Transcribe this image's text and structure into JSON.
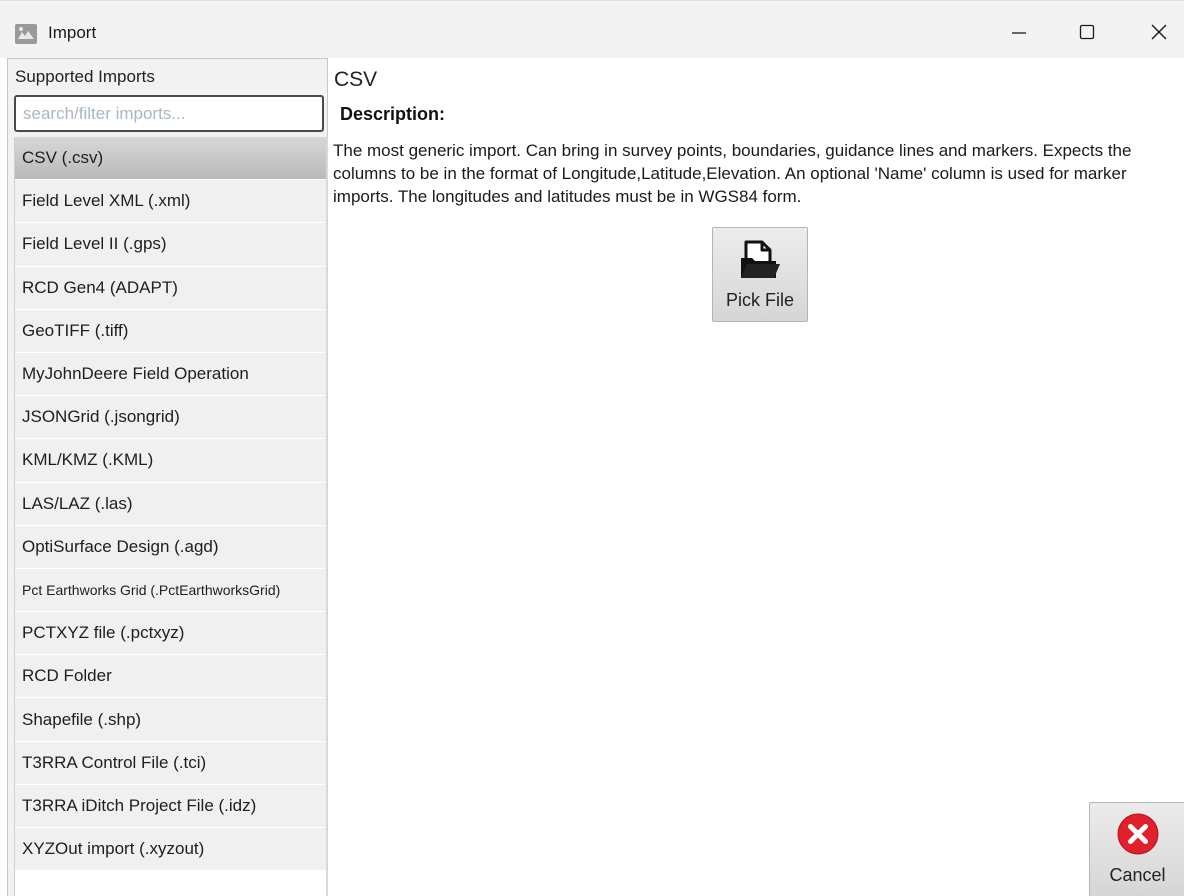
{
  "window": {
    "title": "Import",
    "app_icon": "import-app-icon",
    "controls": {
      "minimize_icon": "minimize-icon",
      "maximize_icon": "maximize-icon",
      "close_icon": "close-icon"
    }
  },
  "sidebar": {
    "header": "Supported Imports",
    "search": {
      "placeholder": "search/filter imports...",
      "value": ""
    },
    "selected_index": 0,
    "items": [
      {
        "label": "CSV (.csv)"
      },
      {
        "label": "Field Level XML (.xml)"
      },
      {
        "label": "Field Level II (.gps)"
      },
      {
        "label": "RCD Gen4 (ADAPT)"
      },
      {
        "label": "GeoTIFF (.tiff)"
      },
      {
        "label": "MyJohnDeere Field Operation"
      },
      {
        "label": "JSONGrid (.jsongrid)"
      },
      {
        "label": "KML/KMZ (.KML)"
      },
      {
        "label": "LAS/LAZ (.las)"
      },
      {
        "label": "OptiSurface Design (.agd)"
      },
      {
        "label": "Pct Earthworks Grid (.PctEarthworksGrid)"
      },
      {
        "label": "PCTXYZ file (.pctxyz)"
      },
      {
        "label": "RCD Folder"
      },
      {
        "label": "Shapefile (.shp)"
      },
      {
        "label": "T3RRA Control File (.tci)"
      },
      {
        "label": "T3RRA iDitch Project File (.idz)"
      },
      {
        "label": "XYZOut import (.xyzout)"
      }
    ]
  },
  "main": {
    "format_title": "CSV",
    "description_label": "Description:",
    "description_text": "The most generic import. Can bring in survey points, boundaries, guidance lines and markers. Expects the columns to be in the format of Longitude,Latitude,Elevation. An optional 'Name' column is used for marker imports. The longitudes and latitudes must be in WGS84 form.",
    "pick_file": {
      "label": "Pick File",
      "icon": "open-folder-icon"
    }
  },
  "footer": {
    "cancel": {
      "label": "Cancel",
      "icon": "cancel-x-icon",
      "icon_color": "#e0202a"
    }
  }
}
